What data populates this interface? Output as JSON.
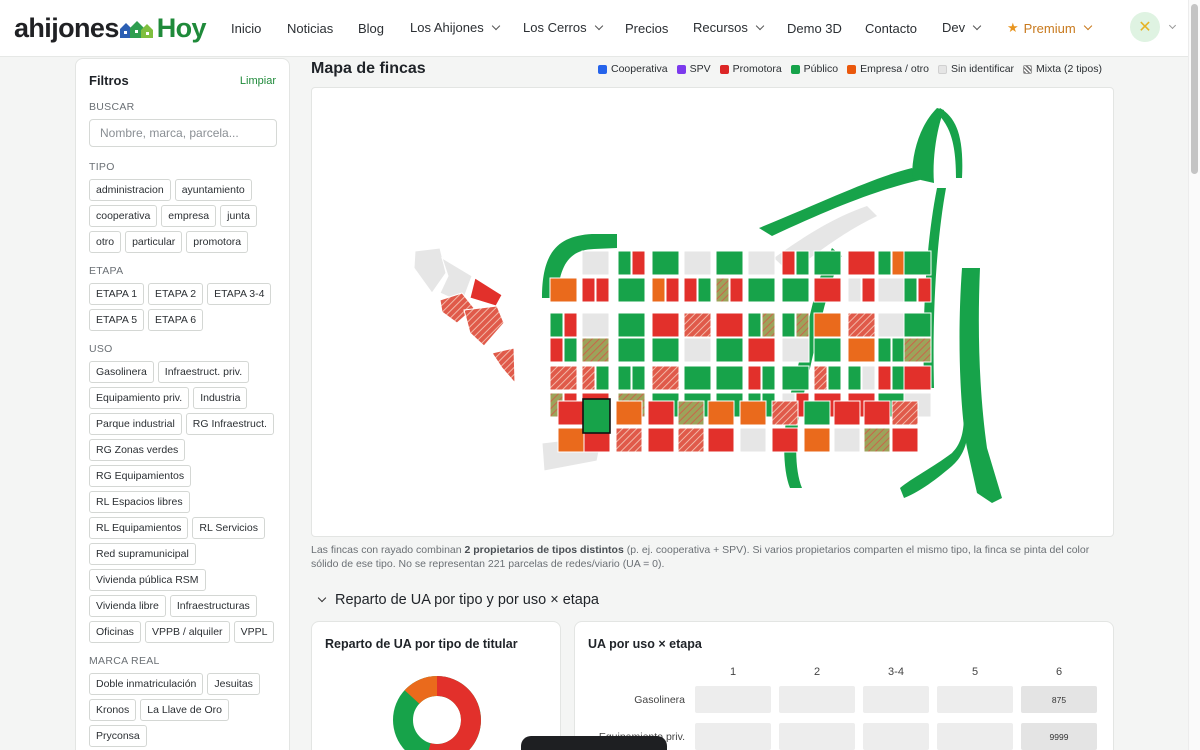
{
  "nav": {
    "logo_a": "ahijones",
    "logo_b": "Hoy",
    "items": [
      {
        "label": "Inicio",
        "dropdown": false
      },
      {
        "label": "Noticias",
        "dropdown": false
      },
      {
        "label": "Blog",
        "dropdown": false
      },
      {
        "label": "Los Ahijones",
        "dropdown": true
      },
      {
        "label": "Los Cerros",
        "dropdown": true
      },
      {
        "label": "Precios",
        "dropdown": false
      },
      {
        "label": "Recursos",
        "dropdown": true
      },
      {
        "label": "Demo 3D",
        "dropdown": false
      },
      {
        "label": "Contacto",
        "dropdown": false
      },
      {
        "label": "Dev",
        "dropdown": true
      }
    ],
    "premium_label": "Premium",
    "avatar_glyph": "✕"
  },
  "filters": {
    "title": "Filtros",
    "clear": "Limpiar",
    "search_label": "BUSCAR",
    "search_placeholder": "Nombre, marca, parcela...",
    "tipo_label": "TIPO",
    "tipo": [
      "administracion",
      "ayuntamiento",
      "cooperativa",
      "empresa",
      "junta",
      "otro",
      "particular",
      "promotora"
    ],
    "etapa_label": "ETAPA",
    "etapa": [
      "ETAPA 1",
      "ETAPA 2",
      "ETAPA 3-4",
      "ETAPA 5",
      "ETAPA 6"
    ],
    "uso_label": "USO",
    "uso": [
      "Gasolinera",
      "Infraestruct. priv.",
      "Equipamiento priv.",
      "Industria",
      "Parque industrial",
      "RG Infraestruct.",
      "RG Zonas verdes",
      "RG Equipamientos",
      "RL Espacios libres",
      "RL Equipamientos",
      "RL Servicios",
      "Red supramunicipal",
      "Vivienda pública RSM",
      "Vivienda libre",
      "Infraestructuras",
      "Oficinas",
      "VPPB / alquiler",
      "VPPL"
    ],
    "marca_label": "MARCA REAL",
    "marca": [
      "Doble inmatriculación",
      "Jesuitas",
      "Kronos",
      "La Llave de Oro",
      "Pryconsa"
    ]
  },
  "map": {
    "title": "Mapa de fincas",
    "legend": [
      {
        "label": "Cooperativa",
        "color": "#2563eb"
      },
      {
        "label": "SPV",
        "color": "#7c3aed"
      },
      {
        "label": "Promotora",
        "color": "#dc2626"
      },
      {
        "label": "Público",
        "color": "#16a34a"
      },
      {
        "label": "Empresa / otro",
        "color": "#ea580c"
      },
      {
        "label": "Sin identificar",
        "color": "#e5e5e5"
      },
      {
        "label": "Mixta (2 tipos)",
        "color": "hatched"
      }
    ],
    "note_a": "Las fincas con rayado combinan ",
    "note_b": "2 propietarios de tipos distintos",
    "note_c": " (p. ej. cooperativa + SPV). Si varios propietarios comparten el mismo tipo, la finca se pinta del color sólido de ese tipo. No se representan 221 parcelas de redes/viario (UA = 0)."
  },
  "section": {
    "title": "Reparto de UA por tipo y por uso × etapa"
  },
  "donut_card": {
    "title": "Reparto de UA por tipo de titular"
  },
  "matrix_card": {
    "title": "UA por uso × etapa",
    "columns": [
      "1",
      "2",
      "3-4",
      "5",
      "6"
    ],
    "rows": [
      {
        "label": "Gasolinera",
        "values": [
          "",
          "",
          "",
          "",
          "875"
        ]
      },
      {
        "label": "Equipamiento priv.",
        "values": [
          "",
          "",
          "",
          "",
          "9999"
        ]
      }
    ]
  }
}
